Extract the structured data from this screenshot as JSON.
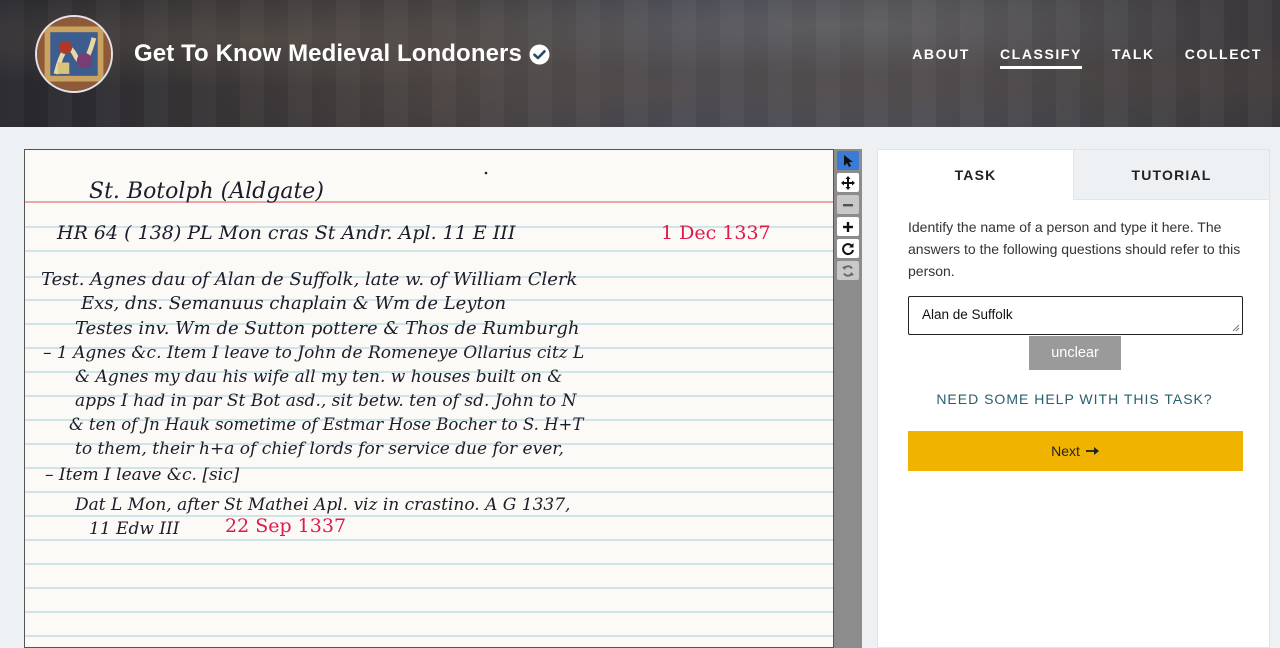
{
  "header": {
    "title": "Get To Know Medieval Londoners",
    "avatar_icon": "illuminated-manuscript-avatar",
    "verified_icon": "verified-check-icon"
  },
  "nav": {
    "items": [
      {
        "label": "ABOUT",
        "active": false
      },
      {
        "label": "CLASSIFY",
        "active": true
      },
      {
        "label": "TALK",
        "active": false
      },
      {
        "label": "COLLECT",
        "active": false
      }
    ]
  },
  "subject": {
    "lines": [
      "St. Botolph (Aldgate)",
      "HR 64 ( 138)   PL Mon cras St Andr. Apl.   11 E III",
      "1 Dec 1337",
      "Test. Agnes dau of Alan de Suffolk, late w. of William Clerk",
      "Exs, dns. Semanuus chaplain & Wm de Leyton",
      "Testes inv. Wm de Sutton pottere & Thos de Rumburgh",
      "– 1 Agnes &c.    Item I leave to John de Romeneye   Ollarius citz L",
      "& Agnes my dau his wife all my ten. w houses built on &",
      "apps I had in par St Bot asd., sit betw. ten of sd. John to N",
      "& ten of Jn Hauk sometime of Estmar Hose Bocher to S.   H+T",
      "to them, their h+a of chief lords for service due for ever,",
      "– Item I leave &c.  [sic]",
      "Dat L Mon, after St Mathei Apl. viz in crastino.  A G 1337,",
      "11 Edw III",
      "22 Sep 1337"
    ],
    "toolbar": [
      {
        "name": "pointer-tool-icon",
        "state": "active"
      },
      {
        "name": "pan-tool-icon",
        "state": "normal"
      },
      {
        "name": "zoom-out-icon",
        "state": "disabled"
      },
      {
        "name": "zoom-in-icon",
        "state": "normal"
      },
      {
        "name": "rotate-icon",
        "state": "normal"
      },
      {
        "name": "reset-view-icon",
        "state": "disabled"
      }
    ]
  },
  "task_panel": {
    "tabs": [
      {
        "label": "TASK",
        "active": true
      },
      {
        "label": "TUTORIAL",
        "active": false
      }
    ],
    "instructions": "Identify the name of a person and type it here. The answers to the following questions should refer to this person.",
    "answer_value": "Alan de Suffolk",
    "unclear_label": "unclear",
    "help_label": "NEED SOME HELP WITH THIS TASK?",
    "next_label": "Next",
    "next_icon": "arrow-right-icon"
  },
  "colors": {
    "next_button": "#f0b400",
    "help_link": "#2a5e6e",
    "active_tool": "#3a7bd5",
    "red_ink": "#e0194a",
    "ruled_line": "#a8cfe0",
    "margin_line": "#e88a8a"
  }
}
